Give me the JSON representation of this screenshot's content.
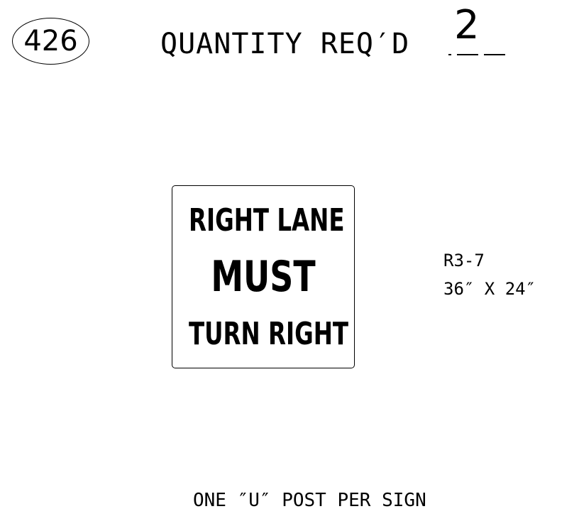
{
  "sheet": {
    "number": "426"
  },
  "quantity": {
    "label": "QUANTITY REQ′D",
    "value": "2"
  },
  "sign": {
    "lines": [
      "RIGHT LANE",
      "MUST",
      "TURN RIGHT"
    ],
    "code": "R3-7",
    "size": "36″ X 24″"
  },
  "note": "ONE ″U″ POST PER SIGN"
}
